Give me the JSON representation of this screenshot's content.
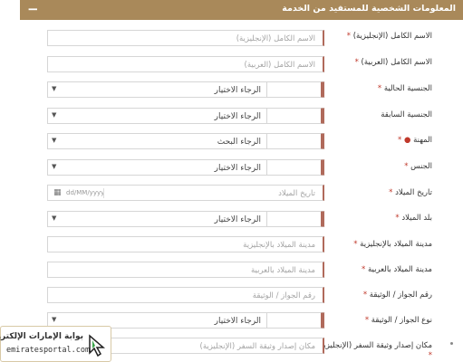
{
  "section": {
    "title": "المعلومات الشخصية للمستفيد من الخدمة",
    "collapse": "−"
  },
  "fields": [
    {
      "label": "الاسم الكامل (الإنجليزية)",
      "required": true,
      "type": "text",
      "placeholder": "الاسم الكامل (الإنجليزية)"
    },
    {
      "label": "الاسم الكامل (العربية)",
      "required": true,
      "type": "text",
      "placeholder": "الاسم الكامل (العربية)"
    },
    {
      "label": "الجنسية الحالية",
      "required": true,
      "type": "select",
      "value": "الرجاء الاختيار"
    },
    {
      "label": "الجنسية السابقة",
      "required": false,
      "type": "select",
      "value": "الرجاء الاختيار"
    },
    {
      "label": "المهنة",
      "required": true,
      "info": true,
      "type": "select",
      "value": "الرجاء البحث"
    },
    {
      "label": "الجنس",
      "required": true,
      "type": "select",
      "value": "الرجاء الاختيار"
    },
    {
      "label": "تاريخ الميلاد",
      "required": true,
      "type": "date",
      "placeholder": "تاريخ الميلاد",
      "format": "dd/MM/yyyy"
    },
    {
      "label": "بلد الميلاد",
      "required": true,
      "type": "select",
      "value": "الرجاء الاختيار"
    },
    {
      "label": "مدينة الميلاد بالإنجليزية",
      "required": true,
      "type": "text",
      "placeholder": "مدينة الميلاد بالإنجليزية"
    },
    {
      "label": "مدينة الميلاد بالعربية",
      "required": true,
      "type": "text",
      "placeholder": "مدينة الميلاد بالعربية"
    },
    {
      "label": "رقم الجواز / الوثيقة",
      "required": true,
      "type": "text",
      "placeholder": "رقم الجواز / الوثيقة"
    },
    {
      "label": "نوع الجواز / الوثيقة",
      "required": true,
      "type": "select",
      "value": "الرجاء الاختيار"
    },
    {
      "label": "مكان إصدار وثيقة السفر (الإنجليزية)",
      "required": true,
      "type": "text",
      "placeholder": "مكان إصدار وثيقة السفر (الإنجليزية)"
    }
  ],
  "watermark": {
    "arabic": "بوابة الإمارات الإلكترونية",
    "domain": "emiratesportal.com"
  },
  "colors": {
    "header": "#a9895a",
    "required": "#c0392b",
    "accent_border": "#b06a5b"
  }
}
